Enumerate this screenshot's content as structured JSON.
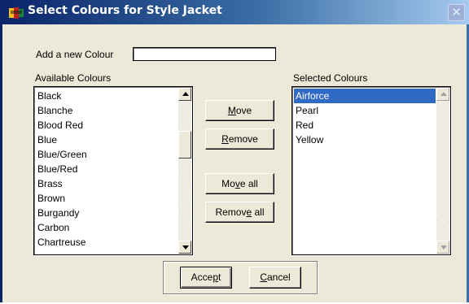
{
  "window": {
    "title": "Select Colours for Style Jacket",
    "close_label": "✕"
  },
  "add_colour": {
    "label": "Add a new Colour",
    "value": ""
  },
  "available": {
    "label": "Available Colours",
    "items": [
      "Black",
      "Blanche",
      "Blood Red",
      "Blue",
      "Blue/Green",
      "Blue/Red",
      "Brass",
      "Brown",
      "Burgandy",
      "Carbon",
      "Chartreuse"
    ]
  },
  "selected": {
    "label": "Selected Colours",
    "items": [
      "Airforce",
      "Pearl",
      "Red",
      "Yellow"
    ],
    "selected_item": "Airforce"
  },
  "buttons": {
    "move": {
      "pre": "",
      "mn": "M",
      "post": "ove"
    },
    "remove": {
      "pre": "",
      "mn": "R",
      "post": "emove"
    },
    "move_all": {
      "pre": "Mo",
      "mn": "v",
      "post": "e all"
    },
    "remove_all": {
      "pre": "Remov",
      "mn": "e",
      "post": " all"
    },
    "accept": {
      "pre": "Acce",
      "mn": "p",
      "post": "t"
    },
    "cancel": {
      "pre": "",
      "mn": "C",
      "post": "ancel"
    }
  },
  "colors": {
    "titlebar_dark": "#0a246a",
    "titlebar_light": "#a6caf0",
    "selection": "#316ac5",
    "face": "#ece9d8"
  }
}
